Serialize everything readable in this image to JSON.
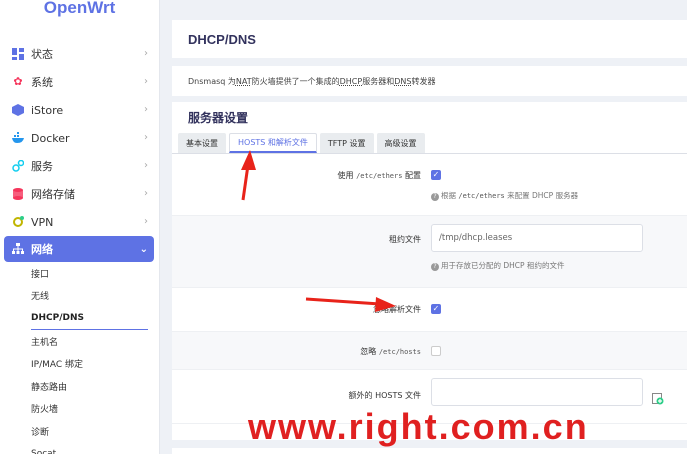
{
  "brand": "OpenWrt",
  "sidebar": {
    "items": [
      {
        "label": "状态",
        "icon": "dashboard-icon"
      },
      {
        "label": "系统",
        "icon": "gear-icon"
      },
      {
        "label": "iStore",
        "icon": "cube-icon"
      },
      {
        "label": "Docker",
        "icon": "docker-icon"
      },
      {
        "label": "服务",
        "icon": "services-icon"
      },
      {
        "label": "网络存储",
        "icon": "storage-icon"
      },
      {
        "label": "VPN",
        "icon": "vpn-icon"
      },
      {
        "label": "网络",
        "icon": "network-icon"
      }
    ],
    "network_sub": [
      "接口",
      "无线",
      "DHCP/DNS",
      "主机名",
      "IP/MAC 绑定",
      "静态路由",
      "防火墙",
      "诊断",
      "Socat"
    ],
    "accent": "#5e72e4"
  },
  "page": {
    "title": "DHCP/DNS",
    "desc_pre": "Dnsmasq 为 ",
    "desc_nat": "NAT",
    "desc_mid": " 防火墙提供了一个集成的 ",
    "desc_dhcp": "DHCP",
    "desc_mid2": " 服务器和 ",
    "desc_dns": "DNS",
    "desc_post": " 转发器",
    "section_title": "服务器设置",
    "tabs": [
      "基本设置",
      "HOSTS 和解析文件",
      "TFTP 设置",
      "高级设置"
    ]
  },
  "form": {
    "ethers_label_pre": "使用 ",
    "ethers_code": "/etc/ethers",
    "ethers_label_post": " 配置",
    "ethers_hint_pre": "根据 ",
    "ethers_hint_code": "/etc/ethers",
    "ethers_hint_post": " 来配置 DHCP 服务器",
    "lease_label": "租约文件",
    "lease_value": "/tmp/dhcp.leases",
    "lease_hint": "用于存放已分配的 DHCP 租约的文件",
    "resolv_label": "忽略解析文件",
    "ignore_hosts_pre": "忽略 ",
    "ignore_hosts_code": "/etc/hosts",
    "extra_hosts_label": "额外的 HOSTS 文件",
    "extra_hosts_value": "",
    "hint_mark": "?",
    "check_mark": "✓"
  },
  "watermark": "www.right.com.cn",
  "annotation_color": "#e8231a"
}
